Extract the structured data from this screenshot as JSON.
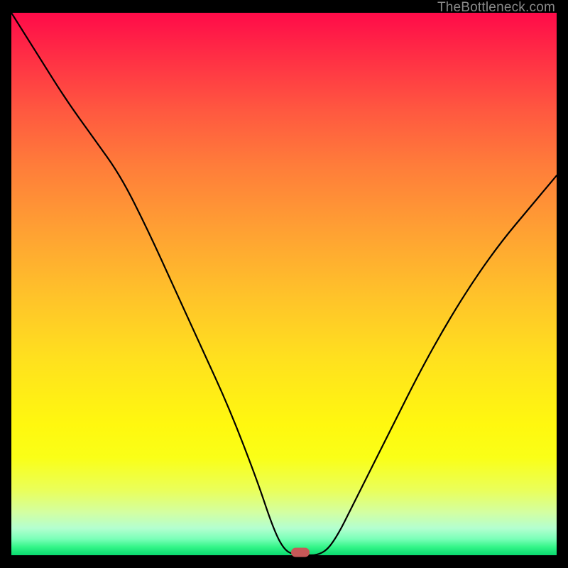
{
  "watermark": "TheBottleneck.com",
  "chart_data": {
    "type": "line",
    "title": "",
    "xlabel": "",
    "ylabel": "",
    "xlim": [
      0,
      100
    ],
    "ylim": [
      0,
      100
    ],
    "series": [
      {
        "name": "bottleneck-curve",
        "x": [
          0,
          5,
          10,
          15,
          20,
          25,
          30,
          35,
          40,
          45,
          48,
          50,
          52,
          54,
          56,
          58,
          60,
          62,
          65,
          70,
          75,
          80,
          85,
          90,
          95,
          100
        ],
        "y": [
          100,
          92,
          84,
          77,
          70,
          60,
          49,
          38,
          27,
          14,
          5,
          1,
          0,
          0,
          0,
          1,
          4,
          8,
          14,
          24,
          34,
          43,
          51,
          58,
          64,
          70
        ]
      }
    ],
    "marker": {
      "x": 53,
      "y": 0.5,
      "color": "#c75858"
    },
    "grid": false,
    "legend": false
  }
}
